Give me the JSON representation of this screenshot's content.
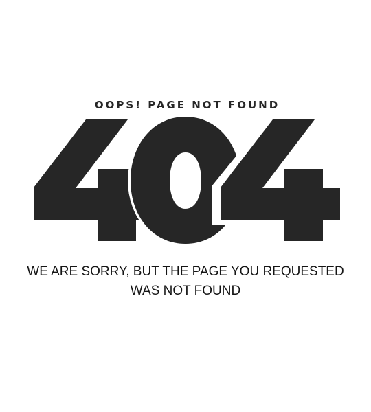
{
  "page": {
    "subtitle": "OOPS! PAGE NOT FOUND",
    "code": "404",
    "message": "WE ARE SORRY, BUT THE PAGE YOU REQUESTED WAS NOT FOUND"
  },
  "colors": {
    "text": "#262626",
    "background": "#ffffff"
  }
}
